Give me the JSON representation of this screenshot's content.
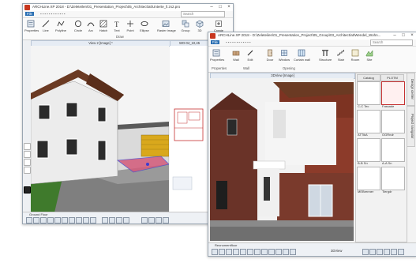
{
  "back_window": {
    "title": "ARCHLine.XP 2018 - D:\\Zeleteilen\\01_Presentation_Project\\05_Architect\\at\\Unterte_ll.zs2.pro",
    "menu": {
      "file": "File",
      "search": "Search"
    },
    "ribbon": {
      "buttons": [
        "Properties",
        "Line",
        "Polyline",
        "Circle",
        "Arc",
        "Hatch",
        "Text",
        "Point",
        "Ellipse",
        "Raster image",
        "Group",
        "3D"
      ],
      "create_label": "Create",
      "group_label": "Draw"
    },
    "views": {
      "main_tab": "View 2 [Image] *",
      "plan_tab": "WO-04_10,45"
    },
    "status": {
      "left_label": "Ground Floor"
    },
    "icon_names": [
      "app-icon",
      "minimize-icon",
      "maximize-icon",
      "close-icon",
      "line-icon",
      "circle-icon",
      "text-icon",
      "3d-box-icon"
    ]
  },
  "front_window": {
    "title": "ARCHLine.XP 2018 - D:\\Zeleteilen\\01_Presentation_Project\\05_Group\\03_Architect\\at\\Wendel_Wohn...",
    "menu": {
      "file": "File",
      "search": "Search"
    },
    "ribbon": {
      "buttons": [
        "Properties",
        "Wall",
        "Edit",
        "Door",
        "Window",
        "Curtain wall",
        "Structure",
        "Stair",
        "Room",
        "Site"
      ],
      "groups": [
        "Properties",
        "Wall",
        "Opening"
      ]
    },
    "view_tab": "3DView [Image]",
    "design_center": {
      "tabs": [
        "Catalog",
        "PLOTM"
      ],
      "thumbs": [
        "C-C Tec",
        "Fassade",
        "ATTikA",
        "OGRndr",
        "B-B Sn",
        "A-A Sn",
        "MEBrenner",
        "Tiergdr"
      ],
      "side_tabs": [
        "Design center",
        "Project navigator"
      ]
    },
    "status": {
      "left_label": "Reonomentfloor",
      "view_label": "3DView"
    }
  },
  "colors": {
    "accent_blue": "#2a6fb3",
    "brick": "#8c3b2a",
    "facade_white": "#eeeeee",
    "roof_brown": "#6b3a23",
    "sky": "#f2f2f2",
    "selection_pink": "#e86a8a"
  }
}
